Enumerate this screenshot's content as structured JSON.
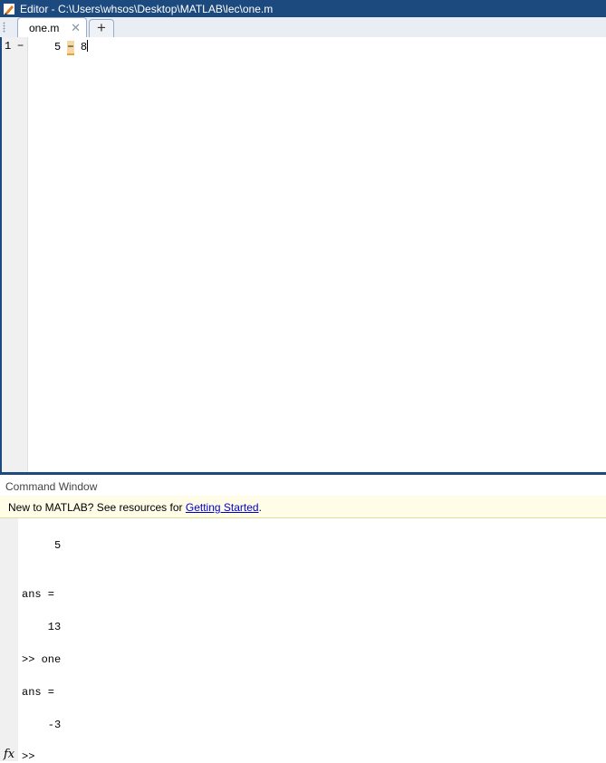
{
  "window": {
    "title": "Editor - C:\\Users\\whsos\\Desktop\\MATLAB\\lec\\one.m"
  },
  "tabs": {
    "active_label": "one.m",
    "close_glyph": "✕",
    "add_glyph": "+"
  },
  "editor": {
    "line_number": "1",
    "breakpoint_marker": "−",
    "code_left": "5",
    "code_operator": "−",
    "code_right": "8"
  },
  "command_window": {
    "title": "Command Window",
    "banner_text": "New to MATLAB? See resources for ",
    "banner_link": "Getting Started",
    "banner_suffix": ".",
    "lines": [
      "     5",
      "ans =",
      "    13",
      ">> one",
      "ans =",
      "    -3"
    ],
    "prompt": ">>",
    "fx_label": "fx"
  },
  "colors": {
    "title_bar": "#1c4a7e",
    "warning_highlight": "#f6d8a6",
    "banner_bg": "#fffde8",
    "link": "#0000cc"
  }
}
